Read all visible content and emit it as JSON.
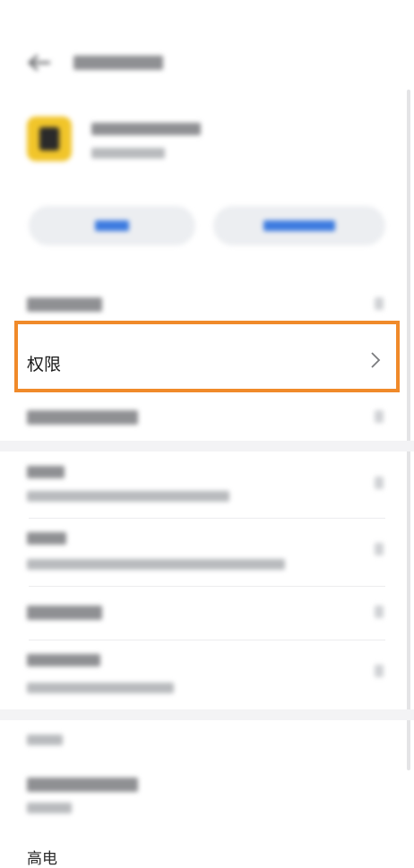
{
  "header": {
    "title": "",
    "back_icon": "arrow-left-icon"
  },
  "app": {
    "name": "",
    "version": "",
    "icon": "app-icon"
  },
  "buttons": {
    "open": "",
    "force_stop": ""
  },
  "permission": {
    "label": "权限",
    "chevron": "chevron-right-icon"
  },
  "footer": {
    "text": "高电"
  },
  "colors": {
    "highlight": "#f08a2a",
    "button_bg": "#eceef1",
    "accent_blurred": "#3d7be0"
  }
}
